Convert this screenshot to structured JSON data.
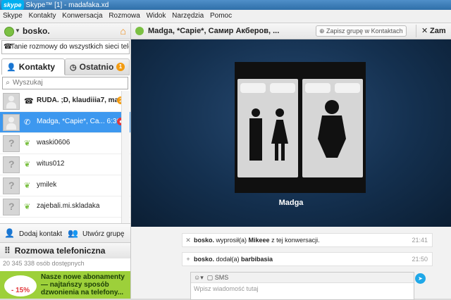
{
  "window": {
    "logo": "skype",
    "title": "Skype™ [1] - madafaka.xd"
  },
  "menu": [
    "Skype",
    "Kontakty",
    "Konwersacja",
    "Rozmowa",
    "Widok",
    "Narzędzia",
    "Pomoc"
  ],
  "user": {
    "name": "bosko.",
    "status_icon": "online-status-icon",
    "home_icon": "home-icon"
  },
  "promo": {
    "text": "Tanie rozmowy do wszystkich sieci telefoni..."
  },
  "tabs": {
    "contacts": {
      "label": "Kontakty",
      "icon": "person-icon"
    },
    "recent": {
      "label": "Ostatnio",
      "icon": "clock-icon",
      "badge": "1"
    }
  },
  "search": {
    "placeholder": "Wyszukaj"
  },
  "contacts": [
    {
      "name": "RUDA. ;D, klaudiiia7, mar...",
      "icon": "phone-hangup-icon",
      "badge": "2",
      "avatar": "group"
    },
    {
      "name": "Madga, *Capie*, Ca... 6:36:47",
      "icon": "phone-icon",
      "badge": "end-call",
      "avatar": "group"
    },
    {
      "name": "waski0606",
      "icon": "status-leaf-icon",
      "avatar": "unknown"
    },
    {
      "name": "witus012",
      "icon": "status-leaf-icon",
      "avatar": "unknown"
    },
    {
      "name": "ymilek",
      "icon": "status-leaf-icon",
      "avatar": "unknown"
    },
    {
      "name": "zajebali.mi.skladaka",
      "icon": "status-leaf-icon",
      "avatar": "unknown"
    }
  ],
  "actions": {
    "add_contact": "Dodaj kontakt",
    "create_group": "Utwórz grupę"
  },
  "call": {
    "label": "Rozmowa telefoniczna"
  },
  "online_count": "20 345 338 osób dostępnych",
  "ad": {
    "percent": "- 15%",
    "lines": [
      "Nasze nowe abonamenty",
      "— najtańszy sposób",
      "dzwonienia na telefony..."
    ]
  },
  "conversation": {
    "title": "Madga, *Capie*, Самир Акберов, ...",
    "save_group": "Zapisz grupę w Kontaktach",
    "next_tab": "Zam",
    "video_caption": "Madga",
    "messages": [
      {
        "icon": "✕",
        "user": "bosko.",
        "text": " wyprosił(a) ",
        "target": "Mikeee",
        "suffix": " z tej konwersacji.",
        "time": "21:41"
      },
      {
        "icon": "+",
        "user": "bosko.",
        "text": " dodał(a) ",
        "target": "barbibasia",
        "suffix": "",
        "time": "21:50"
      }
    ],
    "compose": {
      "mode": "SMS",
      "placeholder": "Wpisz wiadomość tutaj"
    }
  },
  "colors": {
    "accent": "#00aff0",
    "selected": "#3d98ef",
    "online": "#7bc043",
    "ad": "#9dd03a",
    "stage": "#14304f"
  }
}
